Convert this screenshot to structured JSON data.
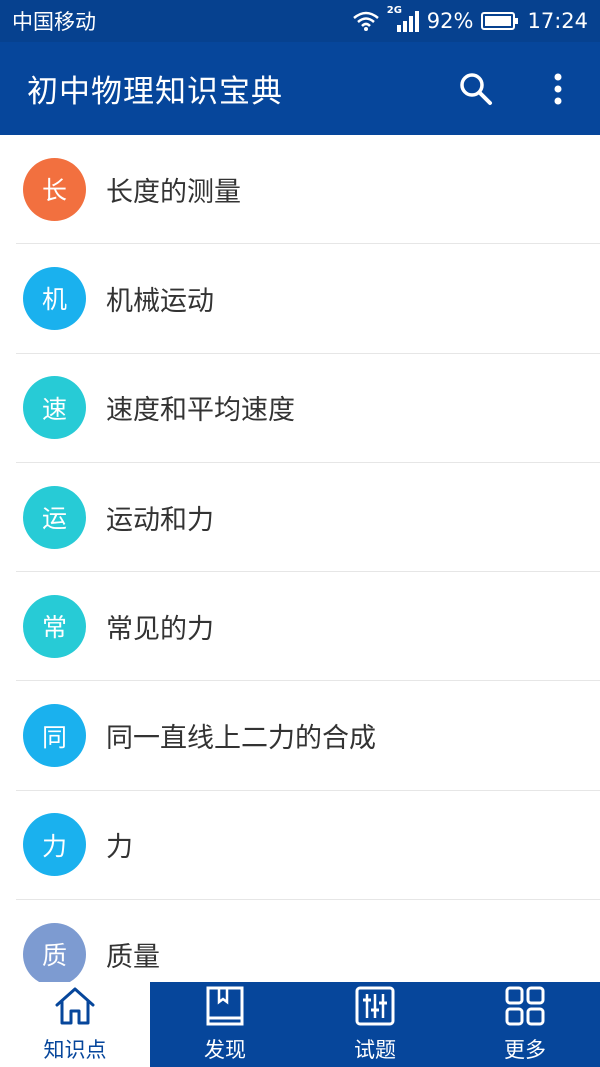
{
  "status_bar": {
    "carrier": "中国移动",
    "network": "2G",
    "battery": "92%",
    "time": "17:24"
  },
  "app_bar": {
    "title": "初中物理知识宝典",
    "search_icon": "search-icon",
    "more_icon": "more-vert-icon"
  },
  "list": {
    "items": [
      {
        "initial": "长",
        "label": "长度的测量",
        "color": "#f2703f"
      },
      {
        "initial": "机",
        "label": "机械运动",
        "color": "#1ab1ee"
      },
      {
        "initial": "速",
        "label": "速度和平均速度",
        "color": "#27cbd6"
      },
      {
        "initial": "运",
        "label": "运动和力",
        "color": "#27cbd6"
      },
      {
        "initial": "常",
        "label": "常见的力",
        "color": "#27cbd6"
      },
      {
        "initial": "同",
        "label": "同一直线上二力的合成",
        "color": "#1ab1ee"
      },
      {
        "initial": "力",
        "label": "力",
        "color": "#1ab1ee"
      },
      {
        "initial": "质",
        "label": "质量",
        "color": "#7d9bd1"
      }
    ]
  },
  "bottom_nav": {
    "items": [
      {
        "label": "知识点",
        "icon": "home-icon",
        "active": true
      },
      {
        "label": "发现",
        "icon": "book-icon",
        "active": false
      },
      {
        "label": "试题",
        "icon": "sliders-icon",
        "active": false
      },
      {
        "label": "更多",
        "icon": "grid-icon",
        "active": false
      }
    ]
  },
  "colors": {
    "primary": "#06469b",
    "status_bar": "#06418f",
    "divider": "#e6e6e6",
    "text": "#333333"
  }
}
